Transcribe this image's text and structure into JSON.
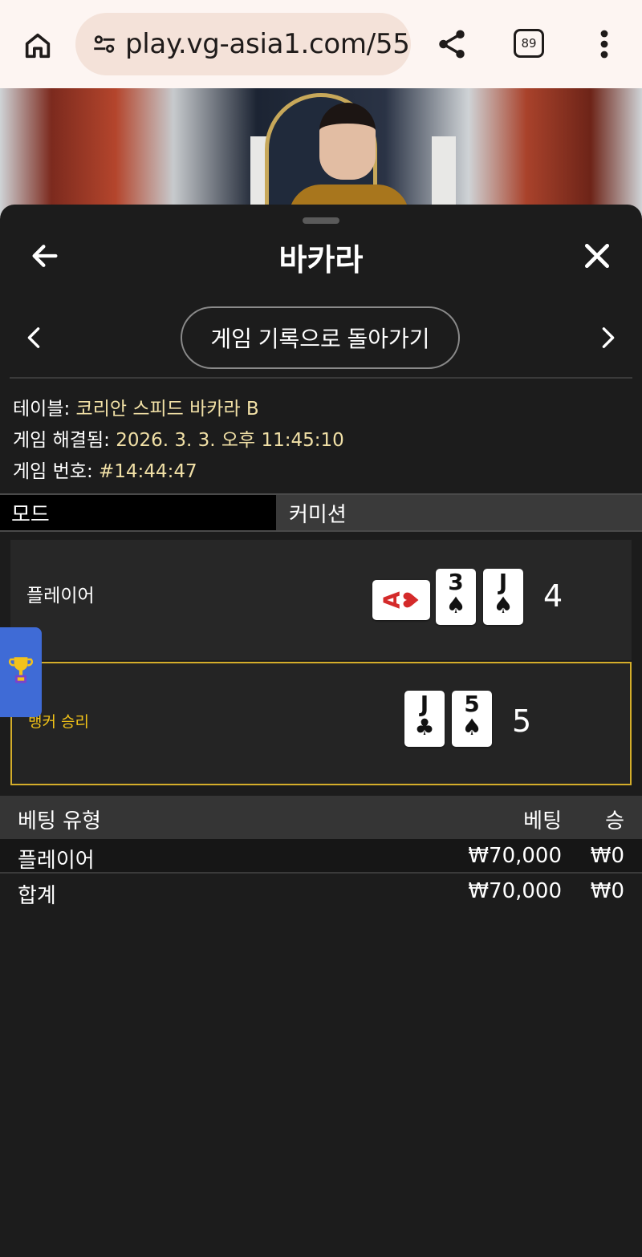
{
  "browser": {
    "url": "play.vg-asia1.com/55",
    "tab_count": "89"
  },
  "panel": {
    "title": "바카라",
    "back_to_history": "게임 기록으로 돌아가기"
  },
  "info": {
    "table_label": "테이블:",
    "table_value": "코리안 스피드 바카라 B",
    "resolved_label": "게임 해결됨:",
    "resolved_value": "2026. 3. 3. 오후 11:45:10",
    "game_no_label": "게임 번호:",
    "game_no_value": "#14:44:47"
  },
  "mode": {
    "label": "모드",
    "value": "커미션"
  },
  "hands": {
    "player": {
      "label": "플레이어",
      "score": "4",
      "cards": [
        {
          "rank": "A",
          "suit": "♥",
          "color": "#d42a2a",
          "sideways": true
        },
        {
          "rank": "3",
          "suit": "♠",
          "color": "#111111"
        },
        {
          "rank": "J",
          "suit": "♠",
          "color": "#111111"
        }
      ]
    },
    "banker": {
      "label": "뱅커 승리",
      "score": "5",
      "cards": [
        {
          "rank": "J",
          "suit": "♣",
          "color": "#111111"
        },
        {
          "rank": "5",
          "suit": "♠",
          "color": "#111111"
        }
      ]
    }
  },
  "bets": {
    "headers": {
      "type": "베팅 유형",
      "bet": "베팅",
      "win": "승"
    },
    "rows": [
      {
        "type": "플레이어",
        "bet": "₩70,000",
        "win": "₩0"
      }
    ],
    "total": {
      "type": "합계",
      "bet": "₩70,000",
      "win": "₩0"
    }
  },
  "colors": {
    "panel_bg": "#1c1c1c",
    "value_text": "#f1e0a6",
    "banker_accent": "#d4ad2a",
    "trophy_tab": "#3f6bd6"
  },
  "icons": [
    "home-icon",
    "tune-icon",
    "share-icon",
    "more-vert-icon",
    "back-arrow-icon",
    "close-icon",
    "chevron-left-icon",
    "chevron-right-icon",
    "trophy-icon"
  ]
}
